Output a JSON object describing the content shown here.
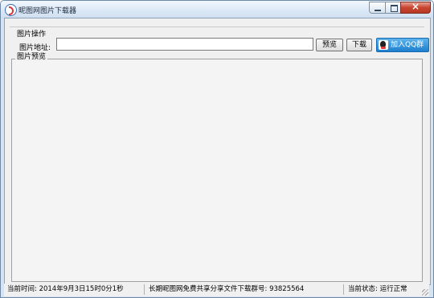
{
  "window": {
    "title": "昵图网图片下载器",
    "icon": "app-logo-icon"
  },
  "group_image_ops": {
    "legend": "图片操作",
    "url_label": "图片地址:",
    "url_value": "",
    "preview_button": "预览",
    "download_button": "下载",
    "qq_button": "加入QQ群"
  },
  "group_preview": {
    "legend": "图片预览"
  },
  "statusbar": {
    "time": "当前时间: 2014年9月3日15时0分1秒",
    "notice": "长期昵图网免费共享分享文件下载群号: 93825564",
    "state": "当前状态: 运行正常"
  }
}
